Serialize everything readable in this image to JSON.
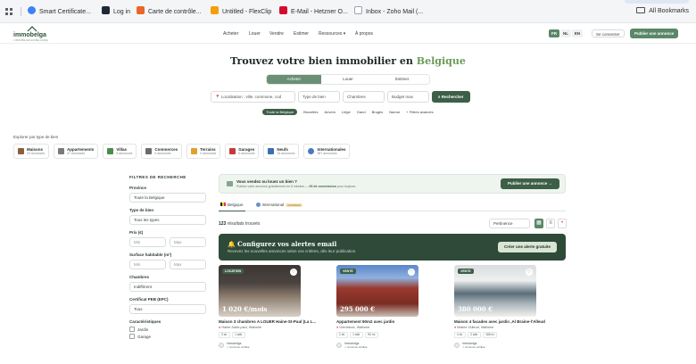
{
  "browser": {
    "bookmarks": [
      {
        "label": "Smart Certificate...",
        "icon": "smart-certificate-favicon",
        "color": "#3b82f6"
      },
      {
        "label": "Log in",
        "icon": "login-favicon",
        "color": "#1f2937"
      },
      {
        "label": "Carte de contrôle...",
        "icon": "carte-favicon",
        "color": "#e8672b"
      },
      {
        "label": "Untitled - FlexClip",
        "icon": "flexclip-favicon",
        "color": "#f59e0b"
      },
      {
        "label": "E-Mail - Hetzner O...",
        "icon": "hetzner-favicon",
        "color": "#d50c2d"
      },
      {
        "label": "Inbox - Zoho Mail (...",
        "icon": "zoho-favicon",
        "color": "#9ca3af"
      }
    ],
    "all_bookmarks": "All Bookmarks"
  },
  "header": {
    "logo": "immobelga",
    "logo_tagline": "L'IMMOBILIER EN BELGIQUE",
    "nav": [
      "Acheter",
      "Louer",
      "Vendre",
      "Estimer",
      "Ressources ▾",
      "À propos"
    ],
    "languages": [
      "FR",
      "NL",
      "EN"
    ],
    "active_language": "FR",
    "login": "Se connecter",
    "publish": "Publier une annonce"
  },
  "hero": {
    "title": "Trouvez votre bien immobilier en",
    "title_accent": "Belgique",
    "tabs": [
      "Acheter",
      "Louer",
      "Estimer"
    ],
    "active_tab": "Acheter",
    "search": {
      "location_placeholder": "Localisation : ville, commune, cod",
      "type": "Type de bien",
      "rooms": "Chambres",
      "budget": "Budget max",
      "button": "Rechercher"
    },
    "cities": [
      "Toute la Belgique",
      "Bruxelles",
      "Anvers",
      "Liège",
      "Gand",
      "Bruges",
      "Namur",
      "+ Filtres avancés"
    ],
    "active_city": "Toute la Belgique"
  },
  "explore": {
    "label": "Explorer par type de bien",
    "types": [
      {
        "name": "Maisons",
        "count": "23 annonces",
        "icon": "house-icon",
        "color": "#8b5e3c"
      },
      {
        "name": "Appartements",
        "count": "47 annonces",
        "icon": "building-icon",
        "color": "#7a7a7a"
      },
      {
        "name": "Villas",
        "count": "6 annonces",
        "icon": "villa-icon",
        "color": "#4e8b4e"
      },
      {
        "name": "Commerces",
        "count": "0 annonces",
        "icon": "shop-icon",
        "color": "#6b6b6b"
      },
      {
        "name": "Terrains",
        "count": "0 annonces",
        "icon": "land-icon",
        "color": "#e0a030"
      },
      {
        "name": "Garages",
        "count": "0 annonces",
        "icon": "garage-icon",
        "color": "#c23b3b"
      },
      {
        "name": "Neufs",
        "count": "16 annonces",
        "icon": "new-build-icon",
        "color": "#3b6fb0"
      },
      {
        "name": "Internationales",
        "count": "387 annonces",
        "icon": "globe-icon",
        "color": "#4a78c2"
      }
    ]
  },
  "filters": {
    "title": "FILTRES DE RECHERCHE",
    "province_label": "Province",
    "province_value": "Toute la Belgique",
    "type_label": "Type de bien",
    "type_value": "Tous les types",
    "price_label": "Prix (€)",
    "min": "Min",
    "max": "Max",
    "surface_label": "Surface habitable (m²)",
    "rooms_label": "Chambres",
    "rooms_value": "Indifférent",
    "peb_label": "Certificat PEB (EPC)",
    "peb_value": "Tous",
    "features_label": "Caractéristiques",
    "features": [
      "Jardin",
      "Garage"
    ]
  },
  "main": {
    "seller_title": "Vous vendez ou louez un bien ?",
    "seller_text": "Publiez votre annonce gratuitement en 5 minutes —",
    "seller_bold": "0€ de commission",
    "seller_tail": "pour toujours.",
    "seller_button": "Publier une annonce →",
    "scope_tabs": [
      {
        "label": "Belgique",
        "icon": "belgium-flag-icon"
      },
      {
        "label": "International",
        "icon": "globe-icon",
        "badge": "NOUVEAU"
      }
    ],
    "active_scope": "Belgique",
    "results_count": "123",
    "results_suffix": "résultats trouvés",
    "sort": "Pertinence",
    "views": [
      "grid-view-icon",
      "list-view-icon",
      "map-view-icon"
    ],
    "alert_title": "🔔 Configurez vos alertes email",
    "alert_text": "Recevez les nouvelles annonces selon vos critères, dès leur publication.",
    "alert_button": "Créer une alerte gratuite"
  },
  "listings": [
    {
      "badge": "LOCATION",
      "price": "1 020 €/mois",
      "title": "Maison 3 chambres A LOUER Haine-St-Paul (La L...",
      "location": "Haine-Saint-paul, Wallonie",
      "features": [
        "3 ch.",
        "1 sdb."
      ],
      "agent": "Immobelga",
      "verified": "✓ Annonce vérifiée",
      "colors": [
        "#3c3633",
        "#8a7a6c",
        "#d8d0c6"
      ]
    },
    {
      "badge": "VENTE",
      "price": "295 000 €",
      "title": "Appartement 90m2 avec jardin",
      "location": "Gembloux, Wallonie",
      "features": [
        "2 ch.",
        "1 sdb.",
        "90 m²"
      ],
      "agent": "Immobelga",
      "verified": "✓ Annonce vérifiée",
      "colors": [
        "#5a86c8",
        "#9a3a2e",
        "#c9c2b8"
      ]
    },
    {
      "badge": "VENTE",
      "price": "380 000 €",
      "title": "Maison 4 facades avec jardin ,Al Braine-l'Alleud",
      "location": "Braine-l'Alleud, Wallonie",
      "features": [
        "4 ch.",
        "2 sdb.",
        "165 m²"
      ],
      "agent": "Immobelga",
      "verified": "✓ Annonce vérifiée",
      "colors": [
        "#d9dde0",
        "#5b6e7a",
        "#f2f2ee"
      ]
    }
  ]
}
